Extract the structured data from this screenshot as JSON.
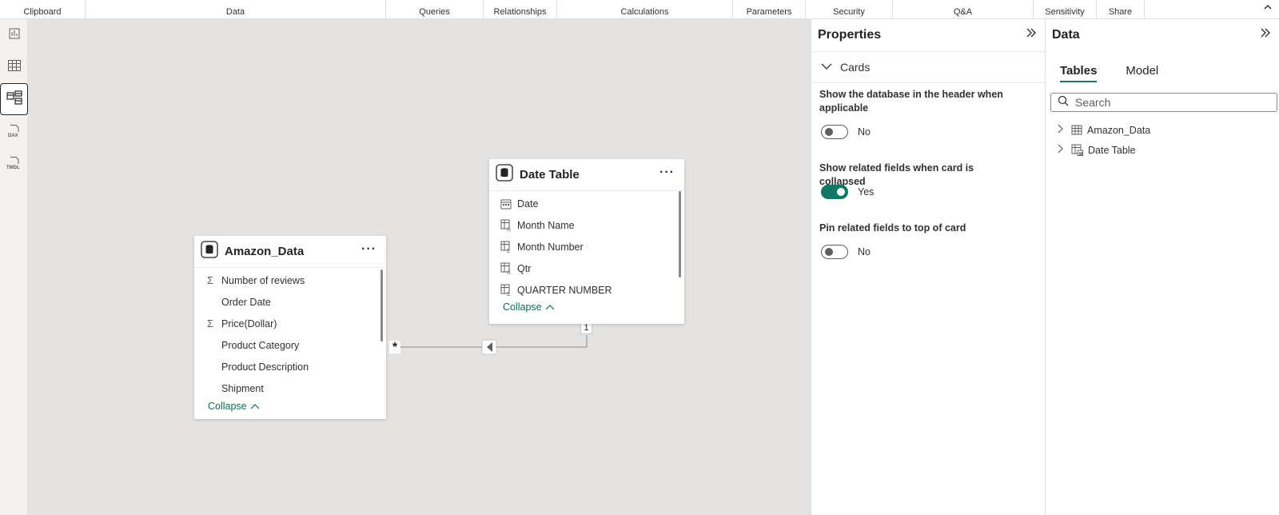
{
  "ribbon": {
    "groups": [
      "Clipboard",
      "Data",
      "Queries",
      "Relationships",
      "Calculations",
      "Parameters",
      "Security",
      "Q&A",
      "Sensitivity",
      "Share"
    ]
  },
  "leftrail": {
    "items": [
      {
        "icon": "report-view-icon"
      },
      {
        "icon": "table-view-icon"
      },
      {
        "icon": "model-view-icon",
        "active": true
      },
      {
        "icon": "dax-query-view-icon"
      },
      {
        "icon": "tmdl-view-icon"
      }
    ]
  },
  "canvas": {
    "amazon_card": {
      "title": "Amazon_Data",
      "more": "···",
      "fields": [
        {
          "icon": "Σ",
          "label": "Number of reviews"
        },
        {
          "icon": "",
          "label": "Order Date"
        },
        {
          "icon": "Σ",
          "label": "Price(Dollar)"
        },
        {
          "icon": "",
          "label": "Product Category"
        },
        {
          "icon": "",
          "label": "Product Description"
        },
        {
          "icon": "",
          "label": "Shipment"
        }
      ],
      "collapse": "Collapse"
    },
    "date_card": {
      "title": "Date Table",
      "more": "···",
      "fields": [
        {
          "icon": "calendar",
          "label": "Date"
        },
        {
          "icon": "calc-column",
          "label": "Month Name"
        },
        {
          "icon": "calc-column",
          "label": "Month Number"
        },
        {
          "icon": "calc-column",
          "label": "Qtr"
        },
        {
          "icon": "calc-column",
          "label": "QUARTER NUMBER"
        }
      ],
      "collapse": "Collapse"
    },
    "relationship": {
      "many_label": "*",
      "one_label": "1"
    }
  },
  "properties": {
    "title": "Properties",
    "section": "Cards",
    "items": [
      {
        "label": "Show the database in the header when applicable",
        "state": "No",
        "on": false
      },
      {
        "label": "Show related fields when card is collapsed",
        "state": "Yes",
        "on": true
      },
      {
        "label": "Pin related fields to top of card",
        "state": "No",
        "on": false
      }
    ]
  },
  "datapane": {
    "title": "Data",
    "tabs": [
      "Tables",
      "Model"
    ],
    "search_placeholder": "Search",
    "tables": [
      "Amazon_Data",
      "Date Table"
    ]
  },
  "colors": {
    "accent": "#117865",
    "link": "#0f6b59",
    "canvas": "#e4e3e2"
  }
}
